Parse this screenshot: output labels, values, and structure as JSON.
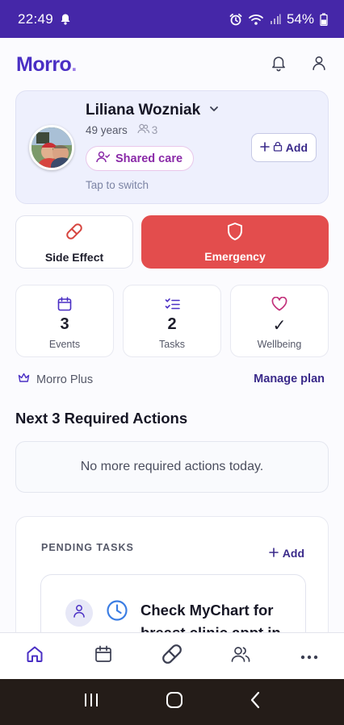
{
  "status_bar": {
    "time": "22:49",
    "battery_percent": "54%",
    "icons": [
      "notification-bell-icon",
      "alarm-icon",
      "wifi-icon",
      "signal-icon",
      "battery-icon"
    ]
  },
  "app_bar": {
    "logo": "Morro",
    "logo_dot": ".",
    "icons": [
      "bell-icon",
      "profile-icon"
    ]
  },
  "profile_card": {
    "name": "Liliana Wozniak",
    "age": "49 years",
    "caregiver_count": "3",
    "shared_care_label": "Shared care",
    "tap_to_switch": "Tap to switch",
    "add_label": "Add"
  },
  "quick_actions": {
    "side_effect_label": "Side Effect",
    "emergency_label": "Emergency"
  },
  "stats": [
    {
      "value": "3",
      "caption": "Events",
      "icon": "calendar-icon"
    },
    {
      "value": "2",
      "caption": "Tasks",
      "icon": "checklist-icon"
    },
    {
      "value": "✓",
      "caption": "Wellbeing",
      "icon": "heart-icon"
    }
  ],
  "plan": {
    "plan_name": "Morro Plus",
    "manage_label": "Manage plan"
  },
  "required_actions": {
    "heading": "Next 3 Required Actions",
    "empty_message": "No more required actions today."
  },
  "pending_tasks": {
    "heading": "PENDING TASKS",
    "add_label": "Add",
    "first_task_title": "Check MyChart for breast clinic appt in"
  },
  "bottom_nav": {
    "items": [
      "home-icon",
      "calendar-icon",
      "pill-icon",
      "people-icon",
      "more-icon"
    ],
    "active": "home-icon"
  },
  "colors": {
    "brand": "#4a2fc4",
    "status_bar": "#4527a8",
    "emergency": "#e34d4d",
    "shared_care": "#8a2aa8"
  }
}
